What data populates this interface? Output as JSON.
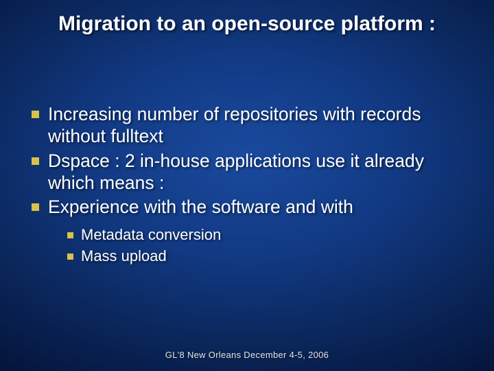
{
  "title": "Migration to an open-source platform :",
  "bullets": [
    "Increasing number of repositories with records without fulltext",
    "Dspace : 2 in-house applications use it already which means :",
    "Experience with the software and with"
  ],
  "subbullets": [
    "Metadata conversion",
    "Mass upload"
  ],
  "footer": "GL'8   New Orleans   December 4-5, 2006"
}
